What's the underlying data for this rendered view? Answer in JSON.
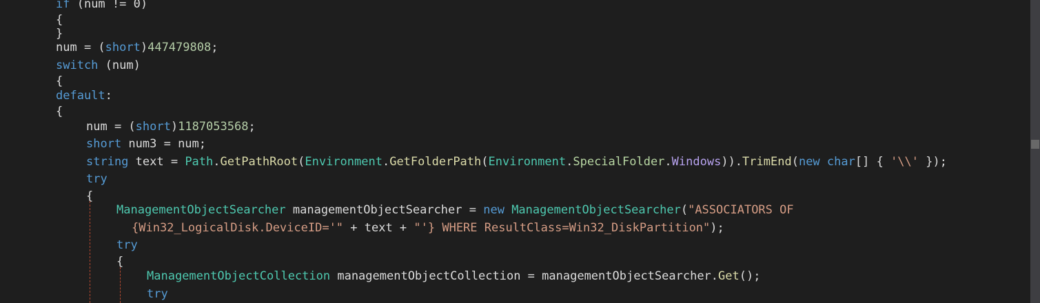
{
  "colors": {
    "background": "#1e1e1e",
    "plain": "#dcdcdc",
    "keyword": "#569cd6",
    "type": "#4ec9b0",
    "method": "#dcdcaa",
    "number": "#b5cea8",
    "string": "#d69d85",
    "enum_member": "#b8d7a3",
    "property": "#b8a3f0",
    "guide": "#b5482f"
  },
  "code": {
    "lines": [
      {
        "tokens": [
          {
            "t": "if",
            "c": "keyword"
          },
          {
            "t": " (num != 0)",
            "c": "plain"
          }
        ]
      },
      {
        "tokens": [
          {
            "t": "{",
            "c": "plain"
          }
        ]
      },
      {
        "tokens": [
          {
            "t": "}",
            "c": "plain"
          }
        ]
      },
      {
        "tokens": [
          {
            "t": "num = (",
            "c": "plain"
          },
          {
            "t": "short",
            "c": "keyword"
          },
          {
            "t": ")",
            "c": "plain"
          },
          {
            "t": "447479808",
            "c": "number"
          },
          {
            "t": ";",
            "c": "plain"
          }
        ]
      },
      {
        "tokens": [
          {
            "t": "switch",
            "c": "keyword"
          },
          {
            "t": " (num)",
            "c": "plain"
          }
        ]
      },
      {
        "tokens": [
          {
            "t": "{",
            "c": "plain"
          }
        ]
      },
      {
        "tokens": [
          {
            "t": "default",
            "c": "keyword"
          },
          {
            "t": ":",
            "c": "plain"
          }
        ]
      },
      {
        "tokens": [
          {
            "t": "{",
            "c": "plain"
          }
        ]
      },
      {
        "tokens": [
          {
            "t": "num = (",
            "c": "plain"
          },
          {
            "t": "short",
            "c": "keyword"
          },
          {
            "t": ")",
            "c": "plain"
          },
          {
            "t": "1187053568",
            "c": "number"
          },
          {
            "t": ";",
            "c": "plain"
          }
        ]
      },
      {
        "tokens": [
          {
            "t": "short",
            "c": "keyword"
          },
          {
            "t": " num3 = num;",
            "c": "plain"
          }
        ]
      },
      {
        "tokens": [
          {
            "t": "string",
            "c": "keyword"
          },
          {
            "t": " text = ",
            "c": "plain"
          },
          {
            "t": "Path",
            "c": "type"
          },
          {
            "t": ".",
            "c": "plain"
          },
          {
            "t": "GetPathRoot",
            "c": "method"
          },
          {
            "t": "(",
            "c": "plain"
          },
          {
            "t": "Environment",
            "c": "type"
          },
          {
            "t": ".",
            "c": "plain"
          },
          {
            "t": "GetFolderPath",
            "c": "method"
          },
          {
            "t": "(",
            "c": "plain"
          },
          {
            "t": "Environment",
            "c": "type"
          },
          {
            "t": ".",
            "c": "plain"
          },
          {
            "t": "SpecialFolder",
            "c": "enum_member"
          },
          {
            "t": ".",
            "c": "plain"
          },
          {
            "t": "Windows",
            "c": "property"
          },
          {
            "t": ")).",
            "c": "plain"
          },
          {
            "t": "TrimEnd",
            "c": "method"
          },
          {
            "t": "(",
            "c": "plain"
          },
          {
            "t": "new",
            "c": "keyword"
          },
          {
            "t": " ",
            "c": "plain"
          },
          {
            "t": "char",
            "c": "keyword"
          },
          {
            "t": "[] { ",
            "c": "plain"
          },
          {
            "t": "'\\\\'",
            "c": "string"
          },
          {
            "t": " });",
            "c": "plain"
          }
        ]
      },
      {
        "tokens": [
          {
            "t": "try",
            "c": "keyword"
          }
        ]
      },
      {
        "tokens": [
          {
            "t": "{",
            "c": "plain"
          }
        ]
      },
      {
        "tokens": [
          {
            "t": "ManagementObjectSearcher",
            "c": "type"
          },
          {
            "t": " managementObjectSearcher = ",
            "c": "plain"
          },
          {
            "t": "new",
            "c": "keyword"
          },
          {
            "t": " ",
            "c": "plain"
          },
          {
            "t": "ManagementObjectSearcher",
            "c": "type"
          },
          {
            "t": "(",
            "c": "plain"
          },
          {
            "t": "\"ASSOCIATORS OF",
            "c": "string"
          }
        ]
      },
      {
        "tokens": [
          {
            "t": "{Win32_LogicalDisk.DeviceID='\"",
            "c": "string"
          },
          {
            "t": " + text + ",
            "c": "plain"
          },
          {
            "t": "\"'} WHERE ResultClass=Win32_DiskPartition\"",
            "c": "string"
          },
          {
            "t": ");",
            "c": "plain"
          }
        ]
      },
      {
        "tokens": [
          {
            "t": "try",
            "c": "keyword"
          }
        ]
      },
      {
        "tokens": [
          {
            "t": "{",
            "c": "plain"
          }
        ]
      },
      {
        "tokens": [
          {
            "t": "ManagementObjectCollection",
            "c": "type"
          },
          {
            "t": " managementObjectCollection = managementObjectSearcher.",
            "c": "plain"
          },
          {
            "t": "Get",
            "c": "method"
          },
          {
            "t": "();",
            "c": "plain"
          }
        ]
      },
      {
        "tokens": [
          {
            "t": "try",
            "c": "keyword"
          }
        ]
      }
    ]
  }
}
